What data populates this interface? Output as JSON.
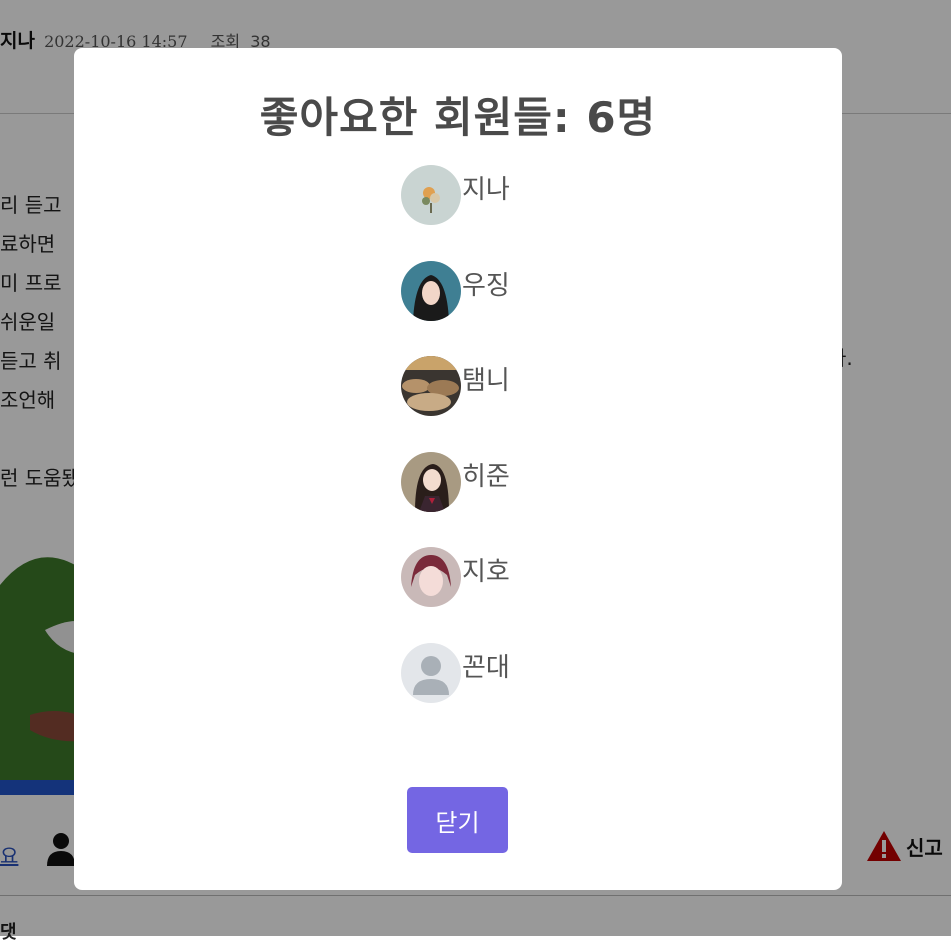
{
  "post": {
    "author": "지나",
    "date": "2022-10-16 14:57",
    "views_label": "조회",
    "views": "38",
    "body_lines": [
      "리 듣고",
      "료하면 ",
      "미 프로",
      "쉬운일 ",
      "듣고 취",
      "조언해",
      "",
      "런 도움됐"
    ],
    "body_right_fragment": "나."
  },
  "footer": {
    "like_link": "요",
    "report_label": "신고",
    "bottom_char": "댓"
  },
  "modal": {
    "title": "좋아요한 회원들: 6명",
    "members": [
      {
        "name": "지나",
        "avatar": "flower-bouquet-avatar"
      },
      {
        "name": "우징",
        "avatar": "girl-portrait-avatar"
      },
      {
        "name": "탬니",
        "avatar": "clouds-landscape-avatar"
      },
      {
        "name": "히준",
        "avatar": "student-portrait-avatar"
      },
      {
        "name": "지호",
        "avatar": "woman-portrait-avatar"
      },
      {
        "name": "꼰대",
        "avatar": "default-user-avatar"
      }
    ],
    "close_label": "닫기"
  },
  "colors": {
    "accent": "#7466e3",
    "overlay": "rgba(0,0,0,0.4)",
    "report_icon": "#c00000"
  }
}
